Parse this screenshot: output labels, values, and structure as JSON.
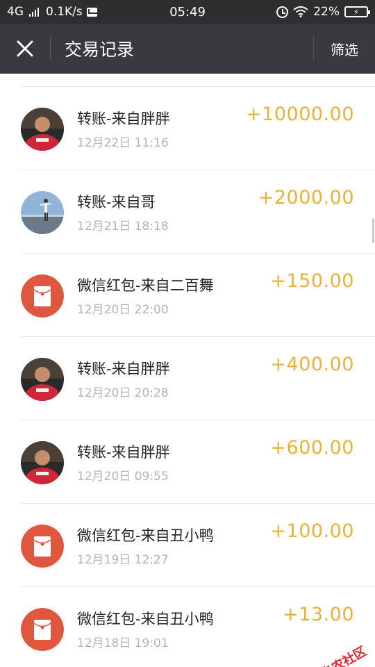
{
  "status_bar": {
    "network": "4G",
    "speed": "0.1K/s",
    "time": "05:49",
    "battery_percent": "22%",
    "icons": [
      "signal-icon",
      "mail-icon",
      "alarm-icon",
      "wifi-icon",
      "battery-charging-icon"
    ]
  },
  "nav": {
    "close_icon": "close-icon",
    "title": "交易记录",
    "filter_label": "筛选"
  },
  "transactions": [
    {
      "title": "转账-来自胖胖",
      "time": "12月22日 11:16",
      "amount": "+10000.00",
      "avatar": "photo-person-red"
    },
    {
      "title": "转账-来自哥",
      "time": "12月21日 18:18",
      "amount": "+2000.00",
      "avatar": "photo-outdoor"
    },
    {
      "title": "微信红包-来自二百舞",
      "time": "12月20日 22:00",
      "amount": "+150.00",
      "avatar": "red-packet-icon"
    },
    {
      "title": "转账-来自胖胖",
      "time": "12月20日 20:28",
      "amount": "+400.00",
      "avatar": "photo-person-red"
    },
    {
      "title": "转账-来自胖胖",
      "time": "12月20日 09:55",
      "amount": "+600.00",
      "avatar": "photo-person-red"
    },
    {
      "title": "微信红包-来自丑小鸭",
      "time": "12月19日 12:27",
      "amount": "+100.00",
      "avatar": "red-packet-icon"
    },
    {
      "title": "微信红包-来自丑小鸭",
      "time": "12月18日 19:01",
      "amount": "+13.00",
      "avatar": "red-packet-icon"
    }
  ],
  "watermark": {
    "text": "卡农社区"
  },
  "colors": {
    "status_bar_bg": "#2e2e30",
    "nav_bg": "#393a3f",
    "amount": "#e8b23a",
    "red_packet": "#e0573f",
    "time_text": "#b4b4b4"
  }
}
